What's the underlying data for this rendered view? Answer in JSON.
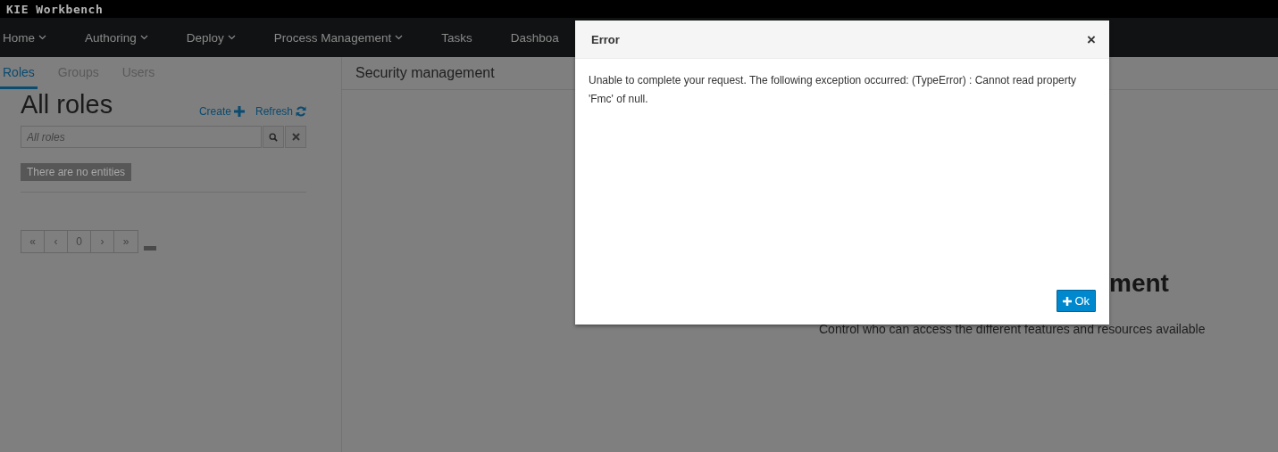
{
  "app_title": "KIE Workbench",
  "nav": [
    {
      "label": "Home",
      "dropdown": true
    },
    {
      "label": "Authoring",
      "dropdown": true
    },
    {
      "label": "Deploy",
      "dropdown": true
    },
    {
      "label": "Process Management",
      "dropdown": true
    },
    {
      "label": "Tasks",
      "dropdown": false
    },
    {
      "label": "Dashboa",
      "dropdown": false
    }
  ],
  "tabs": [
    {
      "label": "Roles",
      "selected": true
    },
    {
      "label": "Groups",
      "selected": false
    },
    {
      "label": "Users",
      "selected": false
    }
  ],
  "list": {
    "title": "All roles",
    "create": "Create",
    "refresh": "Refresh",
    "search": {
      "placeholder": "All roles"
    },
    "empty": "There are no entities",
    "pager": [
      "«",
      "‹",
      "0",
      "›",
      "»"
    ]
  },
  "panel": {
    "title": "Security management",
    "heading": "ment",
    "description": "Control who can access the different features and resources available"
  },
  "dialog": {
    "title": "Error",
    "message": "Unable to complete your request. The following exception occurred: (TypeError) : Cannot read property 'Fmc' of null.",
    "close": "×",
    "ok": "Ok"
  }
}
